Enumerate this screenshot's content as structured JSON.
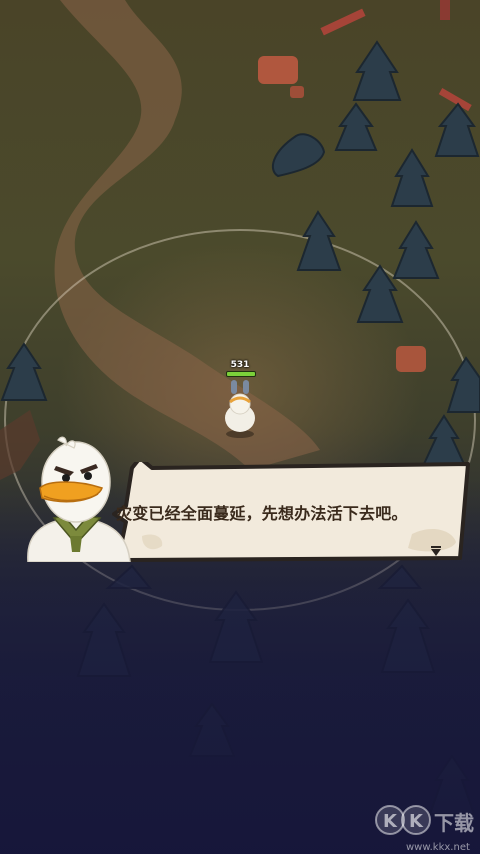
{
  "player": {
    "hp_value": "531"
  },
  "dialog": {
    "text": "灾变已经全面蔓延，先想办法活下去吧。",
    "next_icon": "triangle-down-icon"
  },
  "portrait": {
    "character": "duck-character"
  },
  "watermark": {
    "logo_text": "KK下载",
    "url": "www.kkx.net"
  },
  "colors": {
    "dialog_bg": "#f2eadc",
    "dialog_border": "#2a2420",
    "dialog_text": "#3a2a1c",
    "hp_bar": "#7bd03a",
    "tree": "#2c3d4a",
    "rock": "#b0573e"
  }
}
